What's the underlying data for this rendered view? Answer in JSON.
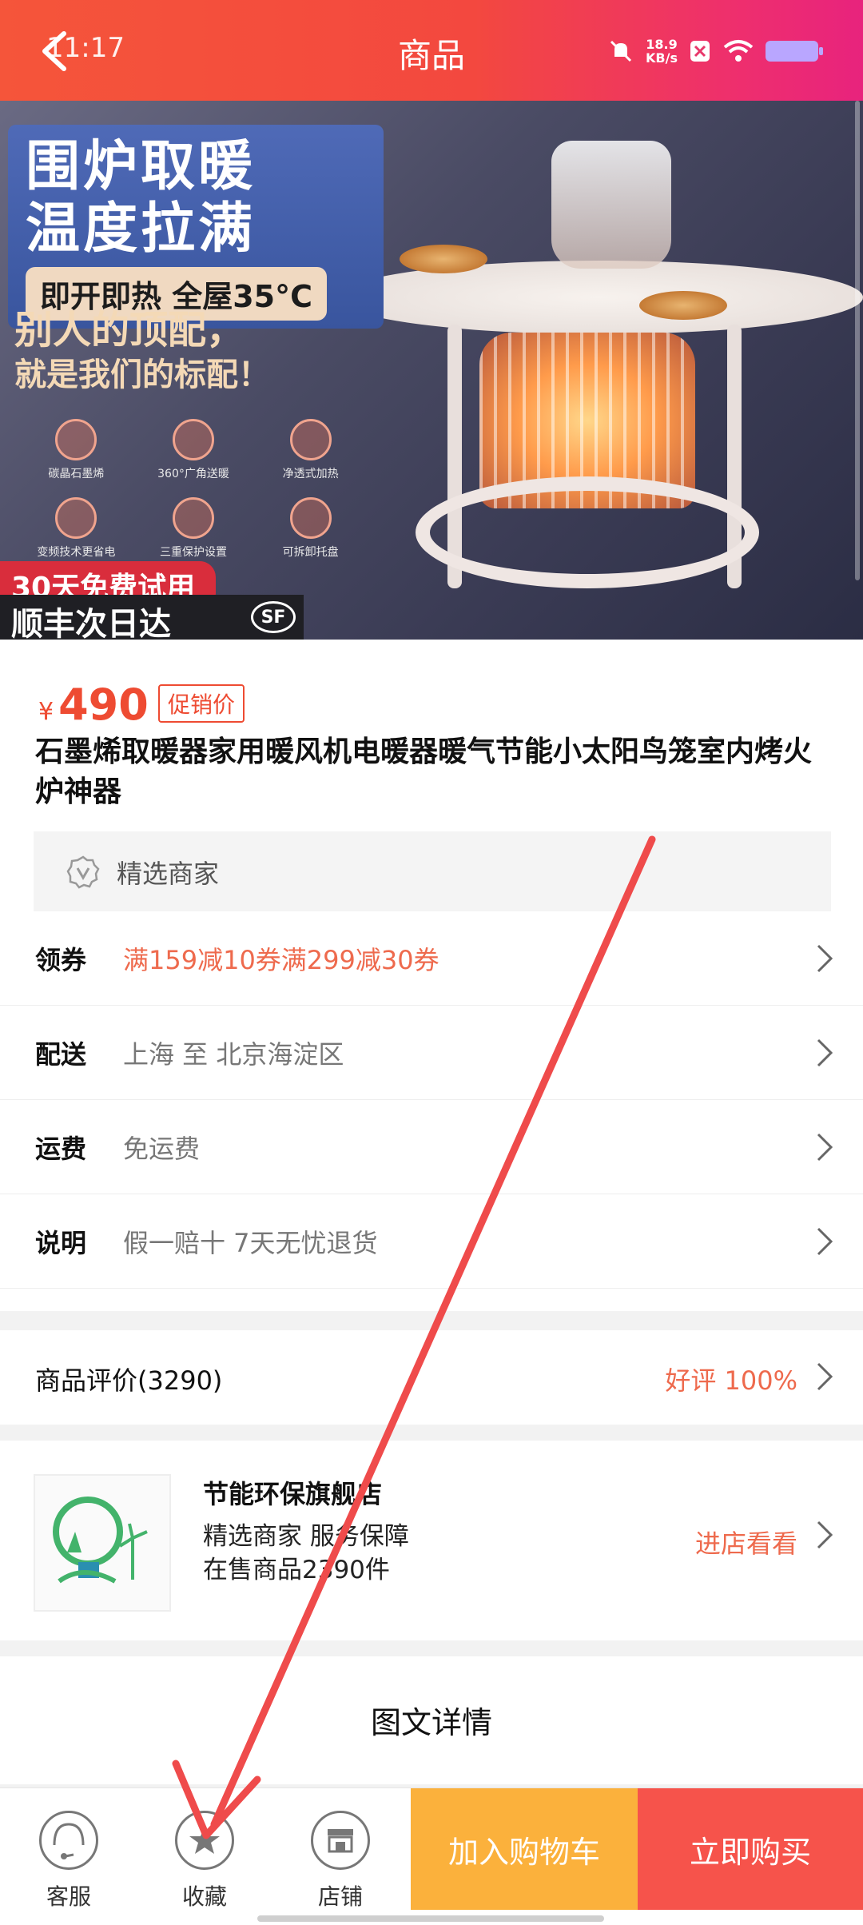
{
  "header": {
    "time": "11:17",
    "title": "商品",
    "network_speed": "18.9",
    "network_unit": "KB/s",
    "icons": [
      "back-arrow-icon",
      "mute-icon",
      "notification-icon",
      "wifi-icon",
      "battery-icon"
    ]
  },
  "hero": {
    "headline_1": "围炉取暖",
    "headline_2": "温度拉满",
    "pill": "即开即热 全屋35°C",
    "tag_1": "别人的顶配，",
    "tag_2": "就是我们的标配！",
    "trial": "30天免费试用",
    "express": "顺丰次日达",
    "sf_logo": "SF",
    "features": [
      "碳晶石墨烯",
      "360°广角送暖",
      "净透式加热",
      "变频技术更省电",
      "三重保护设置",
      "可拆卸托盘"
    ]
  },
  "product": {
    "currency": "¥",
    "price": "490",
    "promo_label": "促销价",
    "title": "石墨烯取暖器家用暖风机电暖器暖气节能小太阳鸟笼室内烤火炉神器",
    "merchant_badge": "精选商家"
  },
  "info_rows": [
    {
      "label": "领券",
      "value": "满159减10券满299减30券",
      "accent": true
    },
    {
      "label": "配送",
      "value": "上海 至 北京海淀区",
      "accent": false
    },
    {
      "label": "运费",
      "value": "免运费",
      "accent": false
    },
    {
      "label": "说明",
      "value": "假一赔十 7天无忧退货",
      "accent": false
    }
  ],
  "reviews": {
    "label": "商品评价(3290)",
    "rating": "好评 100%"
  },
  "shop": {
    "name": "节能环保旗舰店",
    "line2": "精选商家 服务保障",
    "line3": "在售商品2390件",
    "enter": "进店看看"
  },
  "detail": {
    "title": "图文详情"
  },
  "bottom_bar": {
    "service": "客服",
    "favorite": "收藏",
    "store": "店铺",
    "add_to_cart": "加入购物车",
    "buy_now": "立即购买"
  },
  "colors": {
    "header_start": "#f5553a",
    "header_end": "#e8237d",
    "accent_red": "#ee4b32",
    "cart_orange": "#fbb13c",
    "buy_red": "#f6534b",
    "annotation_arrow": "#ef4b4b"
  }
}
